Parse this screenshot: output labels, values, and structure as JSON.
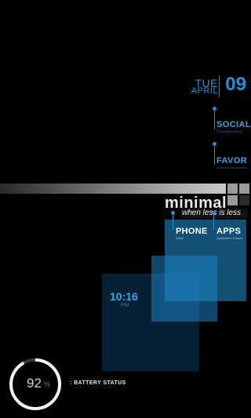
{
  "date": {
    "day": "TUE",
    "month": "APRIL",
    "number": "09"
  },
  "shortcuts": {
    "social": {
      "label": "SOCIAL",
      "sub": "Social Networking"
    },
    "favor": {
      "label": "FAVOR",
      "sub": "Favourite Applications"
    }
  },
  "logo": {
    "name": "minimal",
    "tagline": "when less is less"
  },
  "apps": {
    "phone": {
      "label": "PHONE",
      "sub": "Dialer"
    },
    "apps": {
      "label": "APPS",
      "sub": "Application Drawer"
    }
  },
  "clock": {
    "time": "10:16",
    "ampm": "PM"
  },
  "battery": {
    "percent": "92",
    "symbol": "%",
    "label": ": BATTERY STATUS",
    "level": 0.92
  },
  "colors": {
    "accent": "#2a8fd0",
    "panel": "#1e82c3",
    "background": "#000000"
  }
}
